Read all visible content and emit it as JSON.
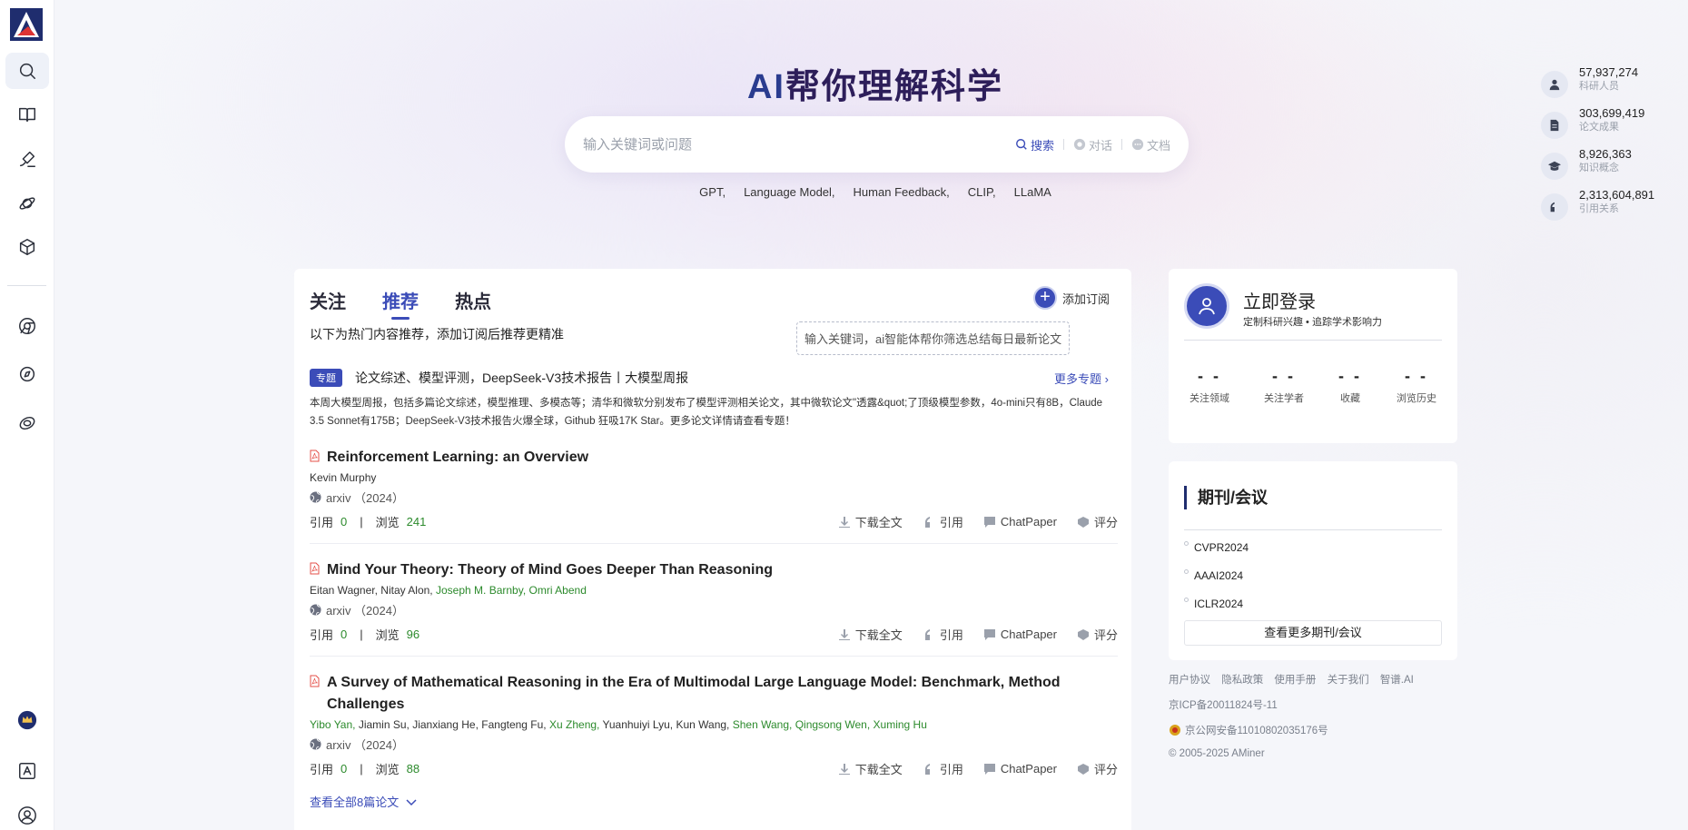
{
  "sidebar": {
    "items": [
      "search-icon",
      "book-icon",
      "pen-icon",
      "planet-icon",
      "cube-icon",
      "chrome-icon",
      "compass-icon",
      "orbit-icon"
    ],
    "bottom": [
      "crown-icon",
      "translate-icon",
      "user-icon"
    ]
  },
  "hero": {
    "title_a": "AI",
    "title_b": "帮你理解科学"
  },
  "search": {
    "placeholder": "输入关键词或问题",
    "mode_search": "搜索",
    "mode_chat": "对话",
    "mode_doc": "文档"
  },
  "hot_keywords": [
    "GPT,",
    "Language Model,",
    "Human Feedback,",
    "CLIP,",
    "LLaMA"
  ],
  "stats": [
    {
      "value": "57,937,274",
      "label": "科研人员",
      "icon": "person-icon"
    },
    {
      "value": "303,699,419",
      "label": "论文成果",
      "icon": "document-icon"
    },
    {
      "value": "8,926,363",
      "label": "知识概念",
      "icon": "graduation-cap-icon"
    },
    {
      "value": "2,313,604,891",
      "label": "引用关系",
      "icon": "quote-icon"
    }
  ],
  "feed": {
    "tabs": [
      "关注",
      "推荐",
      "热点"
    ],
    "add_sub": "添加订阅",
    "tip": "输入关键词，ai智能体帮你筛选总结每日最新论文",
    "hint": "以下为热门内容推荐，添加订阅后推荐更精准",
    "topic": {
      "badge": "专题",
      "title": "论文综述、模型评测，DeepSeek-V3技术报告丨大模型周报",
      "more": "更多专题 ›",
      "desc": "本周大模型周报，包括多篇论文综述，模型推理、多模态等；清华和微软分别发布了模型评测相关论文，其中微软论文\"透露&quot;了顶级模型参数，4o-mini只有8B，Claude 3.5 Sonnet有175B；DeepSeek-V3技术报告火爆全球，Github 狂吸17K Star。更多论文详情请查看专题！"
    },
    "papers": [
      {
        "title": "Reinforcement Learning: an Overview",
        "authors": [
          {
            "n": "Kevin Murphy",
            "hl": false
          }
        ],
        "venue": "arxiv （2024）",
        "cite_label": "引用",
        "cite": "0",
        "view_label": "浏览",
        "views": "241"
      },
      {
        "title": "Mind Your Theory: Theory of Mind Goes Deeper Than Reasoning",
        "authors": [
          {
            "n": "Eitan Wagner,",
            "hl": false
          },
          {
            "n": "Nitay Alon,",
            "hl": false
          },
          {
            "n": "Joseph M. Barnby,",
            "hl": true
          },
          {
            "n": "Omri Abend",
            "hl": true
          }
        ],
        "venue": "arxiv （2024）",
        "cite_label": "引用",
        "cite": "0",
        "view_label": "浏览",
        "views": "96"
      },
      {
        "title": "A Survey of Mathematical Reasoning in the Era of Multimodal Large Language Model: Benchmark, Method Challenges",
        "authors": [
          {
            "n": "Yibo Yan,",
            "hl": true
          },
          {
            "n": "Jiamin Su,",
            "hl": false
          },
          {
            "n": "Jianxiang He,",
            "hl": false
          },
          {
            "n": "Fangteng Fu,",
            "hl": false
          },
          {
            "n": "Xu Zheng,",
            "hl": true
          },
          {
            "n": "Yuanhuiyi Lyu,",
            "hl": false
          },
          {
            "n": "Kun Wang,",
            "hl": false
          },
          {
            "n": "Shen Wang,",
            "hl": true
          },
          {
            "n": "Qingsong Wen,",
            "hl": true
          },
          {
            "n": "Xuming Hu",
            "hl": true
          }
        ],
        "venue": "arxiv （2024）",
        "cite_label": "引用",
        "cite": "0",
        "view_label": "浏览",
        "views": "88"
      }
    ],
    "actions": {
      "download": "下载全文",
      "cite": "引用",
      "chatpaper": "ChatPaper",
      "rate": "评分"
    },
    "view_all": "查看全部8篇论文"
  },
  "login": {
    "title": "立即登录",
    "subtitle": "定制科研兴趣 • 追踪学术影响力",
    "stats": [
      {
        "v": "- -",
        "l": "关注领域"
      },
      {
        "v": "- -",
        "l": "关注学者"
      },
      {
        "v": "- -",
        "l": "收藏"
      },
      {
        "v": "- -",
        "l": "浏览历史"
      }
    ]
  },
  "journals": {
    "title": "期刊/会议",
    "items": [
      "CVPR2024",
      "AAAI2024",
      "ICLR2024"
    ],
    "more": "查看更多期刊/会议"
  },
  "footer": {
    "links": [
      "用户协议",
      "隐私政策",
      "使用手册",
      "关于我们",
      "智谱.AI"
    ],
    "icp": "京ICP备20011824号-11",
    "police": "京公网安备11010802035176号",
    "copyright": "© 2005-2025 AMiner"
  },
  "colors": {
    "accent": "#3b4cb8",
    "green": "#2c8a2c",
    "title": "#1f2d6e"
  }
}
